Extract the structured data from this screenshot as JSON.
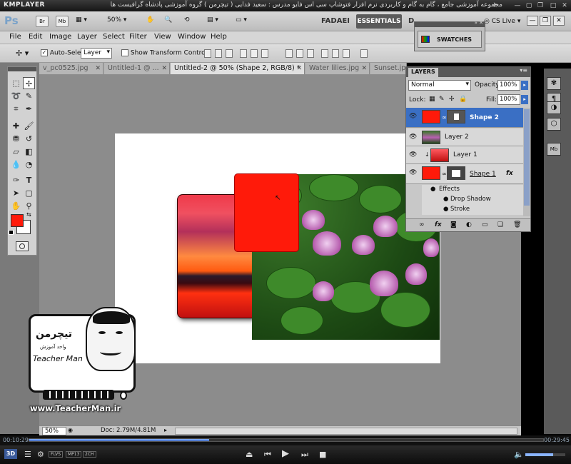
{
  "player": {
    "logo": "KMPLAYER",
    "caption": "مجموعه آموزشی جامع ، گام به گام و کاربردی نرم افزار فتوشاپ سی اس فایو   مدرس : سعید فدایی ( تیچرمن ) گروه آموزشی پادشاه گرافیست ها",
    "time_elapsed": "00:10:29",
    "time_total": "00:29:45",
    "progress": 0.35,
    "badges": [
      "3D",
      "FLVS",
      "MP13",
      "2CH"
    ],
    "volume": 0.7
  },
  "appbar": {
    "logo": "Ps",
    "bridge_label": "Br",
    "minibridge_label": "Mb",
    "zoom": "50%",
    "workspaces": [
      "FADAEI",
      "ESSENTIALS",
      "D"
    ],
    "cs_live": "CS Live"
  },
  "menu": [
    "File",
    "Edit",
    "Image",
    "Layer",
    "Select",
    "Filter",
    "View",
    "Window",
    "Help"
  ],
  "options": {
    "auto_select_label": "Auto-Select:",
    "auto_select_value": "Layer",
    "show_transform_label": "Show Transform Controls"
  },
  "tabs": [
    {
      "label": "v_pc0525.jpg",
      "active": false
    },
    {
      "label": "Untitled-1 @ ...",
      "active": false
    },
    {
      "label": "Untitled-2 @ 50% (Shape 2, RGB/8) *",
      "active": true
    },
    {
      "label": "Water lilies.jpg",
      "active": false
    },
    {
      "label": "Sunset.jpg",
      "active": false
    }
  ],
  "swatches": {
    "label": "SWATCHES"
  },
  "layers": {
    "title": "LAYERS",
    "blend_mode": "Normal",
    "opacity_label": "Opacity:",
    "opacity": "100%",
    "lock_label": "Lock:",
    "fill_label": "Fill:",
    "fill": "100%",
    "rows": [
      {
        "name": "Shape 2",
        "selected": true
      },
      {
        "name": "Layer 2",
        "selected": false
      },
      {
        "name": "Layer 1",
        "selected": false
      },
      {
        "name": "Shape 1",
        "selected": false
      }
    ],
    "effects_label": "Effects",
    "effects": [
      "Drop Shadow",
      "Stroke"
    ],
    "fx_label": "fx"
  },
  "status": {
    "zoom": "50%",
    "doc": "Doc: 2.79M/4.81M"
  },
  "watermark": {
    "url": "www.TeacherMan.ir",
    "name": "Teacher Man",
    "logo_text": "تیچرمن",
    "tagline": "واحد آموزش"
  },
  "colors": {
    "foreground": "#ff1a0a",
    "background": "#ffffff",
    "selection": "#3a6fc4"
  }
}
